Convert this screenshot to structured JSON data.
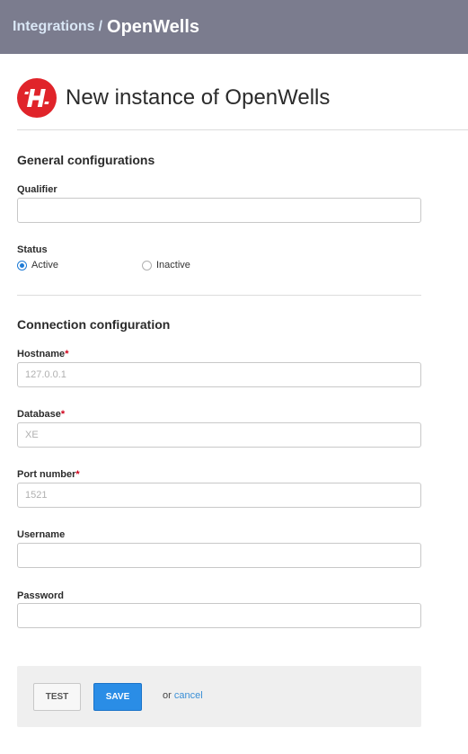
{
  "breadcrumb": {
    "parent": "Integrations",
    "separator": "/",
    "current": "OpenWells"
  },
  "header": {
    "logo_icon": "halliburton-h-logo",
    "title": "New instance of OpenWells"
  },
  "general": {
    "section_title": "General configurations",
    "qualifier_label": "Qualifier",
    "qualifier_value": "",
    "status_label": "Status",
    "status_options": [
      "Active",
      "Inactive"
    ],
    "status_selected": "Active"
  },
  "connection": {
    "section_title": "Connection configuration",
    "hostname_label": "Hostname",
    "hostname_placeholder": "127.0.0.1",
    "database_label": "Database",
    "database_placeholder": "XE",
    "port_label": "Port number",
    "port_placeholder": "1521",
    "username_label": "Username",
    "password_label": "Password",
    "required_marker": "*"
  },
  "actions": {
    "test_label": "TEST",
    "save_label": "SAVE",
    "or_text": "or",
    "cancel_label": "cancel"
  },
  "colors": {
    "topbar": "#7b7c8e",
    "logo": "#e0242a",
    "primary": "#2a8de6",
    "link": "#3a8fd6"
  }
}
